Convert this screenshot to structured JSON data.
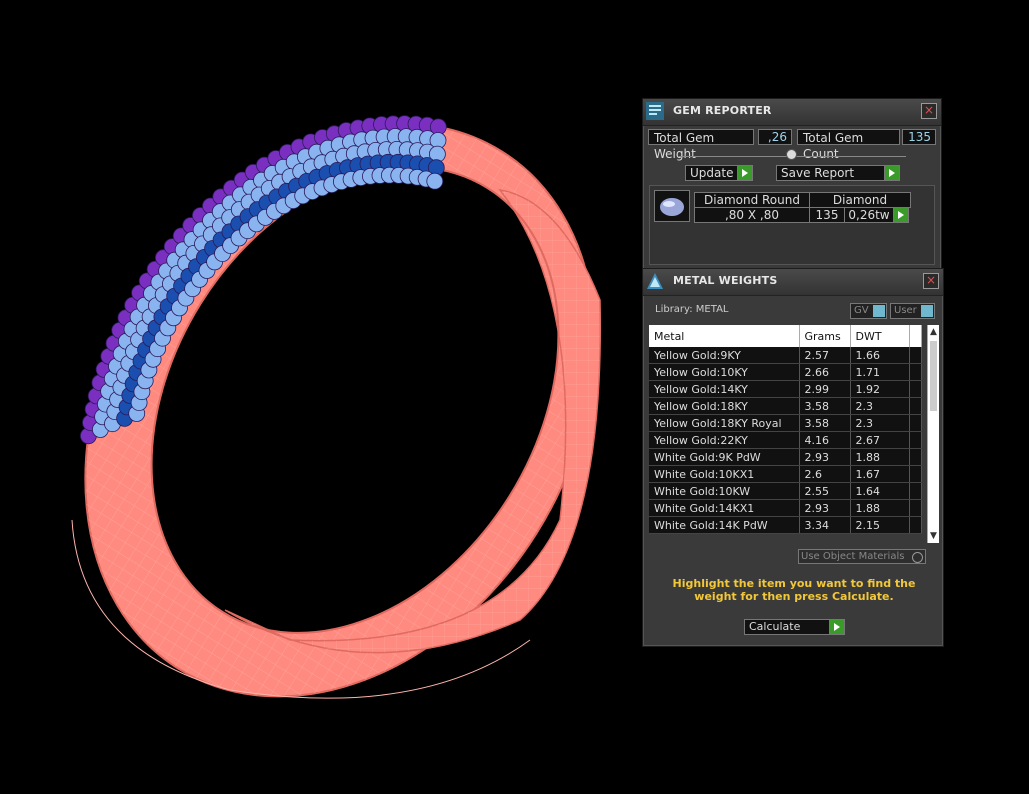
{
  "gem_reporter": {
    "title": "GEM REPORTER",
    "close_label": "×",
    "total_weight_label": "Total Gem Weight",
    "total_weight_value": ",26",
    "total_count_label": "Total Gem Count",
    "total_count_value": "135",
    "update_label": "Update",
    "save_report_label": "Save Report",
    "gem_row": {
      "shape": "Diamond Round",
      "size": ",80 X ,80",
      "material": "Diamond",
      "count": "135",
      "weight": "0,26tw"
    }
  },
  "metal_weights": {
    "title": "METAL WEIGHTS",
    "close_label": "×",
    "library_label": "Library: METAL",
    "gv_label": "GV",
    "user_label": "User",
    "columns": [
      "Metal",
      "Grams",
      "DWT"
    ],
    "rows": [
      {
        "metal": "Yellow Gold:9KY",
        "grams": "2.57",
        "dwt": "1.66"
      },
      {
        "metal": "Yellow Gold:10KY",
        "grams": "2.66",
        "dwt": "1.71"
      },
      {
        "metal": "Yellow Gold:14KY",
        "grams": "2.99",
        "dwt": "1.92"
      },
      {
        "metal": "Yellow Gold:18KY",
        "grams": "3.58",
        "dwt": "2.3"
      },
      {
        "metal": "Yellow Gold:18KY Royal",
        "grams": "3.58",
        "dwt": "2.3"
      },
      {
        "metal": "Yellow Gold:22KY",
        "grams": "4.16",
        "dwt": "2.67"
      },
      {
        "metal": "White Gold:9K PdW",
        "grams": "2.93",
        "dwt": "1.88"
      },
      {
        "metal": "White Gold:10KX1",
        "grams": "2.6",
        "dwt": "1.67"
      },
      {
        "metal": "White Gold:10KW",
        "grams": "2.55",
        "dwt": "1.64"
      },
      {
        "metal": "White Gold:14KX1",
        "grams": "2.93",
        "dwt": "1.88"
      },
      {
        "metal": "White Gold:14K PdW",
        "grams": "3.34",
        "dwt": "2.15"
      }
    ],
    "use_object_materials_label": "Use Object Materials",
    "hint": "Highlight the item you want to find the weight for then press Calculate.",
    "calculate_label": "Calculate"
  },
  "colors": {
    "ring_metal": "#ff8a80",
    "gem_light": "#8ab4f0",
    "gem_purple": "#7b2fc0",
    "gem_blue": "#1a4fb0",
    "accent_green": "#3a9a2a",
    "hint_yellow": "#f2c838"
  }
}
